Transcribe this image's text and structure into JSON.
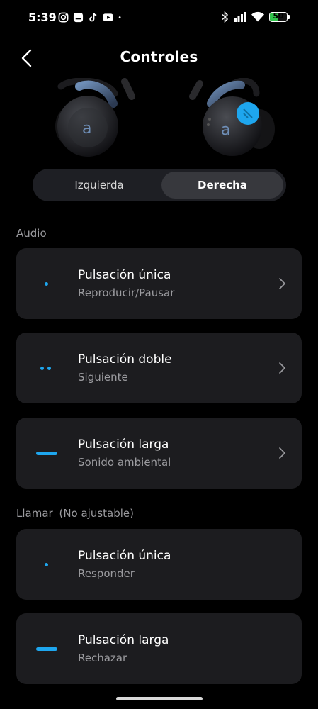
{
  "status_bar": {
    "time": "5:39",
    "battery": "50",
    "battery_level": 0.5,
    "battery_color": "#30c54b",
    "icons": [
      "instagram-icon",
      "app-icon",
      "tiktok-icon",
      "youtube-icon",
      "dot-icon",
      "bluetooth-icon",
      "signal-icon",
      "wifi-icon",
      "battery-icon"
    ]
  },
  "header": {
    "title": "Controles",
    "back_icon": "chevron-left-icon"
  },
  "tabs": {
    "left": "Izquierda",
    "right": "Derecha",
    "selected": "Derecha"
  },
  "audio": {
    "label": "Audio",
    "items": [
      {
        "title": "Pulsación única",
        "subtitle": "Reproducir/Pausar",
        "gesture": "single-tap-icon"
      },
      {
        "title": "Pulsación doble",
        "subtitle": "Siguiente",
        "gesture": "double-tap-icon"
      },
      {
        "title": "Pulsación larga",
        "subtitle": "Sonido ambiental",
        "gesture": "long-press-icon"
      }
    ]
  },
  "call": {
    "label": "Llamar",
    "note": "(No ajustable)",
    "items": [
      {
        "title": "Pulsación única",
        "subtitle": "Responder",
        "gesture": "single-tap-icon"
      },
      {
        "title": "Pulsación larga",
        "subtitle": "Rechazar",
        "gesture": "long-press-icon"
      }
    ]
  },
  "colors": {
    "accent": "#1ea6ee",
    "card": "#1c1c1f",
    "background": "#000000"
  }
}
